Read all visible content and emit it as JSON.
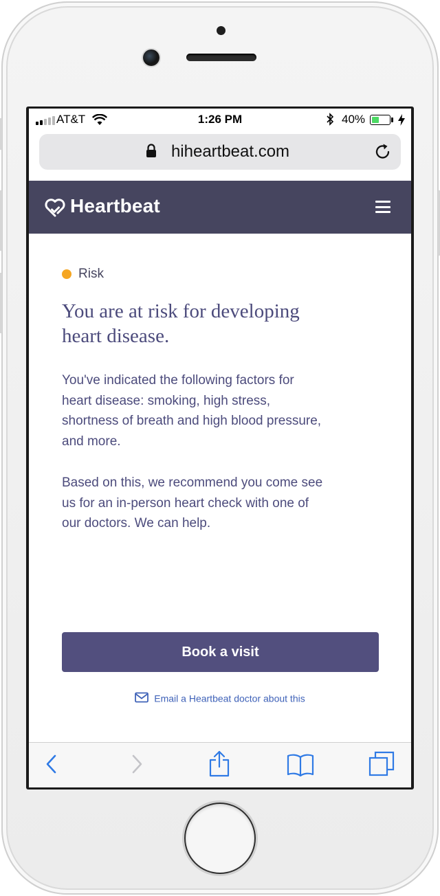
{
  "status_bar": {
    "carrier": "AT&T",
    "time": "1:26 PM",
    "battery_percent": "40%",
    "battery_level": 0.4
  },
  "browser": {
    "url": "hiheartbeat.com"
  },
  "header": {
    "logo_text": "Heartbeat"
  },
  "result": {
    "badge_label": "Risk",
    "badge_color": "#f5a623",
    "headline": "You are at risk for developing heart disease.",
    "paragraph_1": "You've indicated the following factors for heart disease: smoking, high stress, shortness of breath and high blood pressure, and more.",
    "paragraph_2": "Based on this, we recommend you come see us for an in-person heart check with one of our doctors. We can help."
  },
  "actions": {
    "book_label": "Book a visit",
    "email_label": "Email a Heartbeat doctor about this"
  },
  "colors": {
    "header_bg": "#46455f",
    "text": "#4c4b7c",
    "button_bg": "#524f7e",
    "link": "#3f62b8",
    "safari_blue": "#2f7ae5"
  },
  "toolbar": {
    "icons": [
      "back-icon",
      "forward-icon",
      "share-icon",
      "bookmarks-icon",
      "tabs-icon"
    ]
  }
}
